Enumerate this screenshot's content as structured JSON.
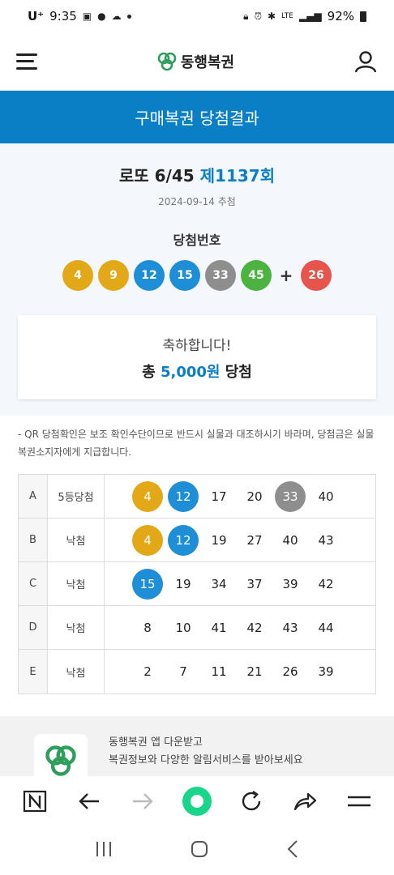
{
  "status_bar": {
    "carrier": "U⁺",
    "time": "9:35",
    "network": "LTE",
    "battery": "92%"
  },
  "header": {
    "logo_text": "동행복권"
  },
  "page_title": "구매복권 당첨결과",
  "draw": {
    "game": "로또 6/45",
    "round": "제1137회",
    "date": "2024-09-14 추첨",
    "winning_label": "당첨번호",
    "numbers": [
      {
        "value": "4",
        "color": "#e3a817"
      },
      {
        "value": "9",
        "color": "#e3a817"
      },
      {
        "value": "12",
        "color": "#1e8fd6"
      },
      {
        "value": "15",
        "color": "#1e8fd6"
      },
      {
        "value": "33",
        "color": "#8e8e8e"
      },
      {
        "value": "45",
        "color": "#4cb240"
      }
    ],
    "plus": "+",
    "bonus": {
      "value": "26",
      "color": "#e6544b"
    }
  },
  "congrats": {
    "message": "축하합니다!",
    "prize_prefix": "총 ",
    "prize_amount": "5,000원",
    "prize_suffix": " 당첨"
  },
  "notice": "- QR 당첨확인은 보조 확인수단이므로 반드시 실물과 대조하시기 바라며, 당첨금은 실물 복권소지자에게 지급합니다.",
  "tickets": [
    {
      "game": "A",
      "result": "5등당첨",
      "numbers": [
        {
          "value": "4",
          "color": "#e3a817"
        },
        {
          "value": "12",
          "color": "#1e8fd6"
        },
        {
          "value": "17",
          "color": ""
        },
        {
          "value": "20",
          "color": ""
        },
        {
          "value": "33",
          "color": "#8e8e8e"
        },
        {
          "value": "40",
          "color": ""
        }
      ]
    },
    {
      "game": "B",
      "result": "낙첨",
      "numbers": [
        {
          "value": "4",
          "color": "#e3a817"
        },
        {
          "value": "12",
          "color": "#1e8fd6"
        },
        {
          "value": "19",
          "color": ""
        },
        {
          "value": "27",
          "color": ""
        },
        {
          "value": "40",
          "color": ""
        },
        {
          "value": "43",
          "color": ""
        }
      ]
    },
    {
      "game": "C",
      "result": "낙첨",
      "numbers": [
        {
          "value": "15",
          "color": "#1e8fd6"
        },
        {
          "value": "19",
          "color": ""
        },
        {
          "value": "34",
          "color": ""
        },
        {
          "value": "37",
          "color": ""
        },
        {
          "value": "39",
          "color": ""
        },
        {
          "value": "42",
          "color": ""
        }
      ]
    },
    {
      "game": "D",
      "result": "낙첨",
      "numbers": [
        {
          "value": "8",
          "color": ""
        },
        {
          "value": "10",
          "color": ""
        },
        {
          "value": "41",
          "color": ""
        },
        {
          "value": "42",
          "color": ""
        },
        {
          "value": "43",
          "color": ""
        },
        {
          "value": "44",
          "color": ""
        }
      ]
    },
    {
      "game": "E",
      "result": "낙첨",
      "numbers": [
        {
          "value": "2",
          "color": ""
        },
        {
          "value": "7",
          "color": ""
        },
        {
          "value": "11",
          "color": ""
        },
        {
          "value": "21",
          "color": ""
        },
        {
          "value": "26",
          "color": ""
        },
        {
          "value": "39",
          "color": ""
        }
      ]
    }
  ],
  "app_banner": {
    "line1": "동행복권 앱 다운받고",
    "line2": "복권정보와 다양한 알림서비스를 받아보세요"
  },
  "browser_toolbar": {
    "items": [
      "n-icon",
      "back-arrow-icon",
      "forward-arrow-icon",
      "home-circle-icon",
      "refresh-icon",
      "share-icon",
      "menu-icon"
    ]
  },
  "colors": {
    "brand_blue": "#0a7fc5",
    "brand_green": "#2e9e5b"
  }
}
